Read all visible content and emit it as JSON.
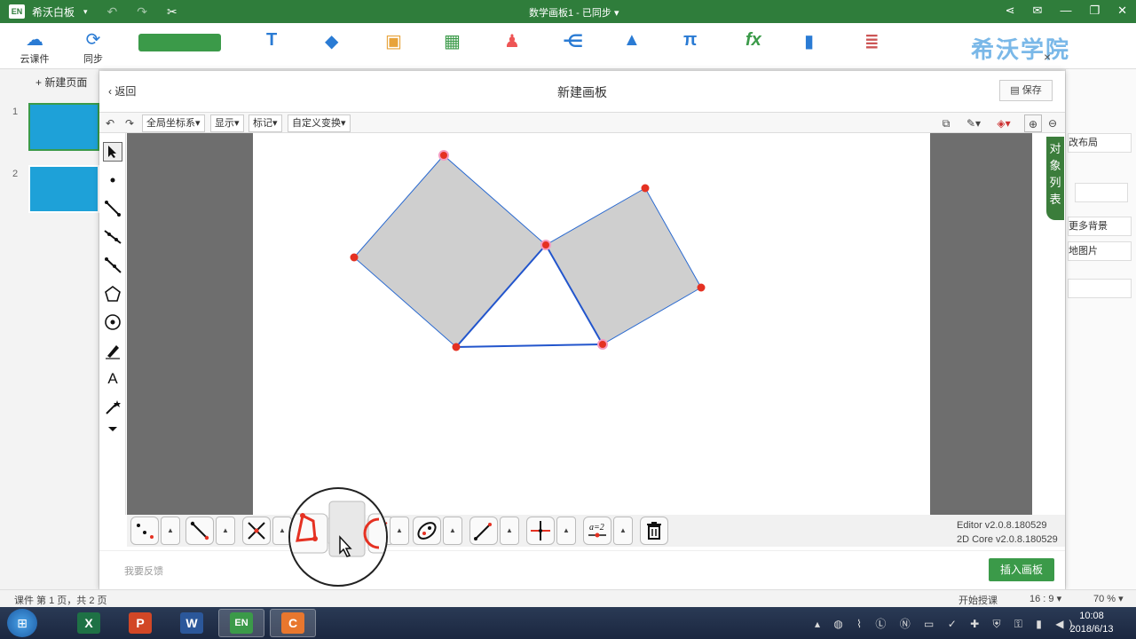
{
  "titlebar": {
    "app_logo": "EN",
    "app_name": "希沃白板",
    "doc_title": "数学画板1 - 已同步 ▾"
  },
  "ribbon": {
    "cloud_label": "云课件",
    "sync_label": "同步",
    "brand": "希沃学院"
  },
  "pages_panel": {
    "new_page": "+ 新建页面",
    "pages": [
      "1",
      "2"
    ]
  },
  "dialog": {
    "back": "返回",
    "title": "新建画板",
    "save": "保存",
    "close": "×",
    "toolbar": {
      "coord_system": "全局坐标系▾",
      "display": "显示▾",
      "mark": "标记▾",
      "custom_transform": "自定义变换▾"
    },
    "object_list_tab": [
      "对",
      "象",
      "列",
      "表"
    ],
    "version_editor": "Editor v2.0.8.180529",
    "version_core": "2D Core v2.0.8.180529",
    "feedback": "我要反馈",
    "insert": "插入画板"
  },
  "props_panel": {
    "items": [
      "改布局",
      "更多背景",
      "地图片"
    ]
  },
  "statusbar": {
    "page_info": "课件 第 1 页，共 2 页",
    "start_teaching": "开始授课",
    "ratio": "16 : 9 ▾",
    "zoom": "70 % ▾"
  },
  "taskbar": {
    "apps": [
      "X",
      "P",
      "W",
      "EN",
      "C"
    ],
    "time": "10:08",
    "date": "2018/6/13"
  },
  "colors": {
    "brand_green": "#2f7d3b",
    "point_red": "#e53122",
    "segment_blue": "#2255cc",
    "fill_gray": "#cfcfcf"
  }
}
